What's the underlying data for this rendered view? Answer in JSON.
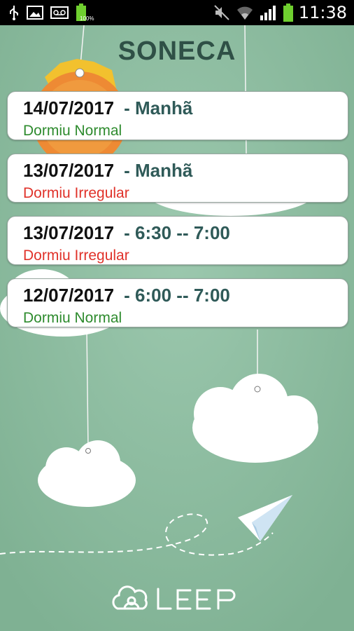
{
  "status_bar": {
    "battery_small_label": "100%",
    "time": "11:38"
  },
  "screen_title": "SONECA",
  "entries": [
    {
      "date": "14/07/2017",
      "period": "- Manhã",
      "status": "Dormiu Normal",
      "status_type": "normal"
    },
    {
      "date": "13/07/2017",
      "period": "- Manhã",
      "status": "Dormiu Irregular",
      "status_type": "irregular"
    },
    {
      "date": "13/07/2017",
      "period": "- 6:30 -- 7:00",
      "status": "Dormiu Irregular",
      "status_type": "irregular"
    },
    {
      "date": "12/07/2017",
      "period": "- 6:00 -- 7:00",
      "status": "Dormiu Normal",
      "status_type": "normal"
    }
  ],
  "colors": {
    "background": "#8fbda2",
    "title": "#2f5046",
    "status_normal": "#2e8b2e",
    "status_irregular": "#e0322a",
    "period": "#2f5a58"
  },
  "brand": {
    "logo_text": "LEEP"
  }
}
